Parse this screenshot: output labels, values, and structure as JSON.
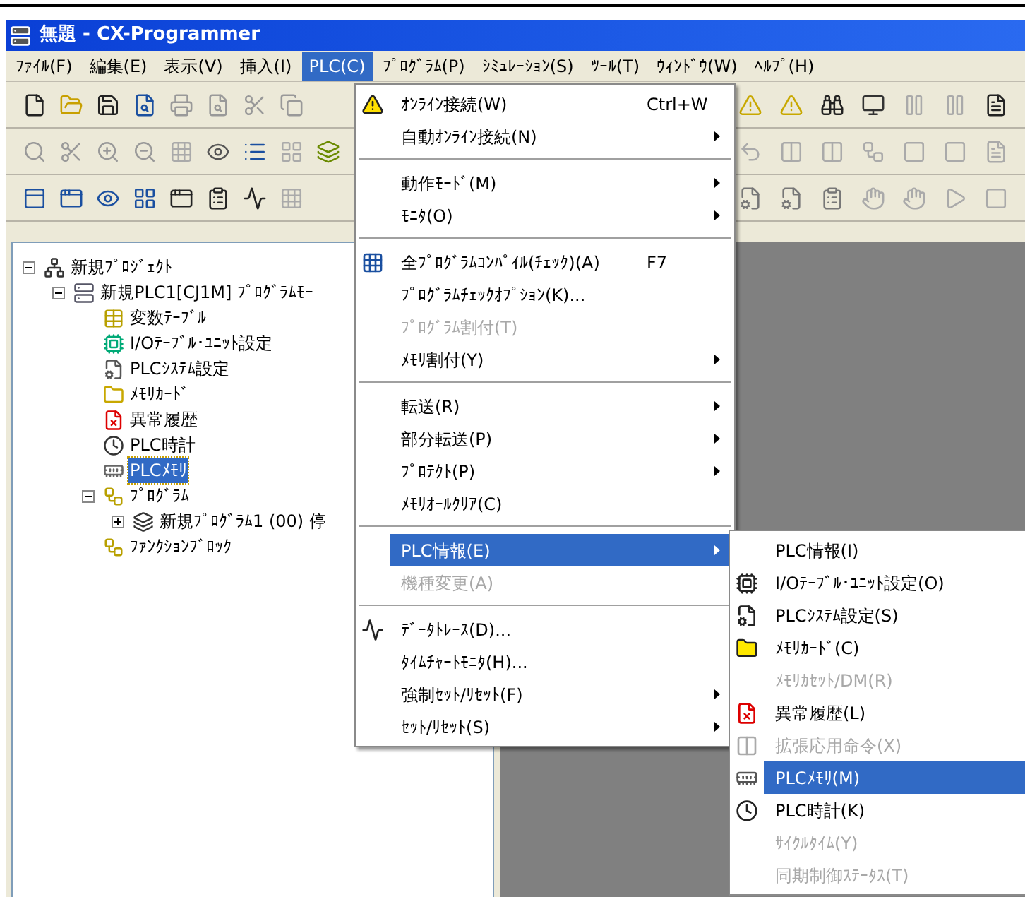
{
  "window": {
    "title": "無題 - CX-Programmer"
  },
  "menubar": {
    "items": [
      {
        "label": "ﾌｧｲﾙ(F)",
        "selected": false
      },
      {
        "label": "編集(E)",
        "selected": false
      },
      {
        "label": "表示(V)",
        "selected": false
      },
      {
        "label": "挿入(I)",
        "selected": false
      },
      {
        "label": "PLC(C)",
        "selected": true
      },
      {
        "label": "ﾌﾟﾛｸﾞﾗﾑ(P)",
        "selected": false
      },
      {
        "label": "ｼﾐｭﾚｰｼｮﾝ(S)",
        "selected": false
      },
      {
        "label": "ﾂｰﾙ(T)",
        "selected": false
      },
      {
        "label": "ｳｨﾝﾄﾞｳ(W)",
        "selected": false
      },
      {
        "label": "ﾍﾙﾌﾟ(H)",
        "selected": false
      }
    ]
  },
  "tree": {
    "items": [
      {
        "label": "新規ﾌﾟﾛｼﾞｪｸﾄ",
        "selected": false,
        "expanded": true,
        "children": [
          {
            "label": "新規PLC1[CJ1M] ﾌﾟﾛｸﾞﾗﾑﾓｰ",
            "selected": false,
            "expanded": true,
            "children": [
              {
                "label": "変数ﾃｰﾌﾞﾙ",
                "selected": false
              },
              {
                "label": "I/Oﾃｰﾌﾞﾙ･ﾕﾆｯﾄ設定",
                "selected": false
              },
              {
                "label": "PLCｼｽﾃﾑ設定",
                "selected": false
              },
              {
                "label": "ﾒﾓﾘｶｰﾄﾞ",
                "selected": false
              },
              {
                "label": "異常履歴",
                "selected": false
              },
              {
                "label": "PLC時計",
                "selected": false
              },
              {
                "label": "PLCﾒﾓﾘ",
                "selected": true
              },
              {
                "label": "ﾌﾟﾛｸﾞﾗﾑ",
                "selected": false,
                "expanded": true,
                "children": [
                  {
                    "label": "新規ﾌﾟﾛｸﾞﾗﾑ1 (00) 停",
                    "selected": false,
                    "expanded": false
                  }
                ]
              },
              {
                "label": "ﾌｧﾝｸｼｮﾝﾌﾞﾛｯｸ",
                "selected": false
              }
            ]
          }
        ]
      }
    ]
  },
  "plc_menu": {
    "items": [
      {
        "kind": "item",
        "label": "ｵﾝﾗｲﾝ接続(W)",
        "shortcut": "Ctrl+W",
        "disabled": false,
        "submenu": false,
        "selected": false
      },
      {
        "kind": "item",
        "label": "自動ｵﾝﾗｲﾝ接続(N)",
        "disabled": false,
        "submenu": true,
        "selected": false
      },
      {
        "kind": "separator"
      },
      {
        "kind": "item",
        "label": "動作ﾓｰﾄﾞ(M)",
        "disabled": false,
        "submenu": true,
        "selected": false
      },
      {
        "kind": "item",
        "label": "ﾓﾆﾀ(O)",
        "disabled": false,
        "submenu": true,
        "selected": false
      },
      {
        "kind": "separator"
      },
      {
        "kind": "item",
        "label": "全ﾌﾟﾛｸﾞﾗﾑｺﾝﾊﾟｲﾙ(ﾁｪｯｸ)(A)",
        "shortcut": "F7",
        "disabled": false,
        "submenu": false,
        "selected": false
      },
      {
        "kind": "item",
        "label": "ﾌﾟﾛｸﾞﾗﾑﾁｪｯｸｵﾌﾟｼｮﾝ(K)...",
        "disabled": false,
        "submenu": false,
        "selected": false
      },
      {
        "kind": "item",
        "label": "ﾌﾟﾛｸﾞﾗﾑ割付(T)",
        "disabled": true,
        "submenu": false,
        "selected": false
      },
      {
        "kind": "item",
        "label": "ﾒﾓﾘ割付(Y)",
        "disabled": false,
        "submenu": true,
        "selected": false
      },
      {
        "kind": "separator"
      },
      {
        "kind": "item",
        "label": "転送(R)",
        "disabled": false,
        "submenu": true,
        "selected": false
      },
      {
        "kind": "item",
        "label": "部分転送(P)",
        "disabled": false,
        "submenu": true,
        "selected": false
      },
      {
        "kind": "item",
        "label": "ﾌﾟﾛﾃｸﾄ(P)",
        "disabled": false,
        "submenu": true,
        "selected": false
      },
      {
        "kind": "item",
        "label": "ﾒﾓﾘｵｰﾙｸﾘｱ(C)",
        "disabled": false,
        "submenu": false,
        "selected": false
      },
      {
        "kind": "separator"
      },
      {
        "kind": "item",
        "label": "PLC情報(E)",
        "disabled": false,
        "submenu": true,
        "selected": true
      },
      {
        "kind": "item",
        "label": "機種変更(A)",
        "disabled": true,
        "submenu": false,
        "selected": false
      },
      {
        "kind": "separator"
      },
      {
        "kind": "item",
        "label": "ﾃﾞｰﾀﾄﾚｰｽ(D)...",
        "disabled": false,
        "submenu": false,
        "selected": false
      },
      {
        "kind": "item",
        "label": "ﾀｲﾑﾁｬｰﾄﾓﾆﾀ(H)...",
        "disabled": false,
        "submenu": false,
        "selected": false
      },
      {
        "kind": "item",
        "label": "強制ｾｯﾄ/ﾘｾｯﾄ(F)",
        "disabled": false,
        "submenu": true,
        "selected": false
      },
      {
        "kind": "item",
        "label": "ｾｯﾄ/ﾘｾｯﾄ(S)",
        "disabled": false,
        "submenu": true,
        "selected": false
      }
    ]
  },
  "plc_info_menu": {
    "items": [
      {
        "kind": "item",
        "label": "PLC情報(I)",
        "disabled": false,
        "selected": false
      },
      {
        "kind": "item",
        "label": "I/Oﾃｰﾌﾞﾙ･ﾕﾆｯﾄ設定(O)",
        "disabled": false,
        "selected": false
      },
      {
        "kind": "item",
        "label": "PLCｼｽﾃﾑ設定(S)",
        "disabled": false,
        "selected": false
      },
      {
        "kind": "item",
        "label": "ﾒﾓﾘｶｰﾄﾞ(C)",
        "disabled": false,
        "selected": false
      },
      {
        "kind": "item",
        "label": "ﾒﾓﾘｶｾｯﾄ/DM(R)",
        "disabled": true,
        "selected": false
      },
      {
        "kind": "item",
        "label": "異常履歴(L)",
        "disabled": false,
        "selected": false
      },
      {
        "kind": "item",
        "label": "拡張応用命令(X)",
        "disabled": true,
        "selected": false
      },
      {
        "kind": "item",
        "label": "PLCﾒﾓﾘ(M)",
        "disabled": false,
        "selected": true
      },
      {
        "kind": "item",
        "label": "PLC時計(K)",
        "disabled": false,
        "selected": false
      },
      {
        "kind": "item",
        "label": "ｻｲｸﾙﾀｲﾑ(Y)",
        "disabled": true,
        "selected": false
      },
      {
        "kind": "item",
        "label": "同期制御ｽﾃｰﾀｽ(T)",
        "disabled": true,
        "selected": false
      }
    ]
  }
}
